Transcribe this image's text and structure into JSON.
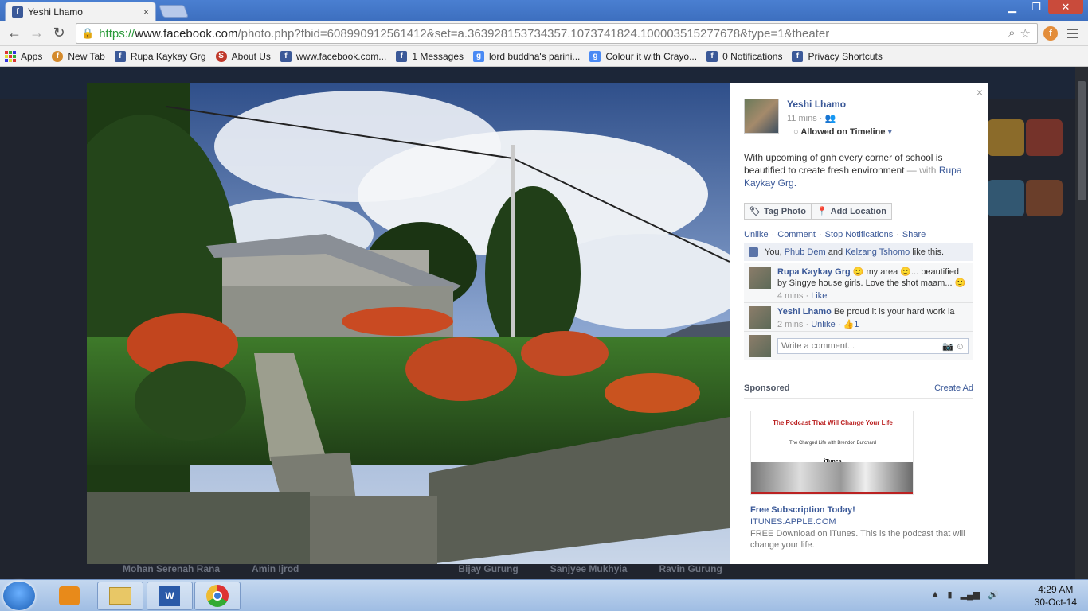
{
  "browser": {
    "tab_title": "Yeshi Lhamo",
    "tab_close": "×",
    "url_scheme": "https://",
    "url_host": "www.facebook.com",
    "url_path": "/photo.php?fbid=608990912561412&set=a.363928153734357.1073741824.100003515277678&type=1&theater",
    "window_controls": [
      "▁",
      "❐",
      "✕"
    ]
  },
  "bookmarks": [
    {
      "label": "Apps",
      "icon": "apps-icon"
    },
    {
      "label": "New Tab",
      "icon": "newtab-icon"
    },
    {
      "label": "Rupa Kaykay Grg",
      "icon": "facebook-icon"
    },
    {
      "label": "About Us",
      "icon": "site-icon"
    },
    {
      "label": "www.facebook.com...",
      "icon": "facebook-icon"
    },
    {
      "label": "1 Messages",
      "icon": "facebook-icon"
    },
    {
      "label": "lord buddha's parini...",
      "icon": "google-icon"
    },
    {
      "label": "Colour it with Crayo...",
      "icon": "google-icon"
    },
    {
      "label": "0 Notifications",
      "icon": "facebook-icon"
    },
    {
      "label": "Privacy Shortcuts",
      "icon": "facebook-icon"
    }
  ],
  "post": {
    "author": "Yeshi Lhamo",
    "time": "11 mins ·",
    "privacy": "Allowed on Timeline",
    "caption": "With upcoming of gnh every corner of school is beautified to create fresh environment",
    "with_text": "— with",
    "tagged": "Rupa Kaykay Grg",
    "tagged_end": ".",
    "buttons": {
      "tag_photo": "Tag Photo",
      "add_location": "Add Location"
    },
    "actions": {
      "unlike": "Unlike",
      "comment": "Comment",
      "stop_notifications": "Stop Notifications",
      "share": "Share",
      "sep": "·"
    },
    "likes": {
      "you": "You,",
      "p1": "Phub Dem",
      "and": "and",
      "p2": "Kelzang Tshomo",
      "tail": "like this."
    },
    "comments": [
      {
        "name": "Rupa Kaykay Grg",
        "text": "🙂 my area 🙂... beautified by Singye house girls. Love the shot maam... 🙂",
        "time": "4 mins ·",
        "action": "Like",
        "likes": ""
      },
      {
        "name": "Yeshi Lhamo",
        "text": "Be proud it is your hard work la",
        "time": "2 mins ·",
        "action": "Unlike",
        "likes": "· 👍1"
      }
    ],
    "write_placeholder": "Write a comment...",
    "close": "×"
  },
  "sponsored": {
    "title": "Sponsored",
    "create_ad": "Create Ad",
    "ad_headline": "The Podcast That Will Change Your Life",
    "ad_sub": "The Charged Life with Brendon Burchard",
    "ad_brand": "iTunes",
    "ad_title": "Free Subscription Today!",
    "ad_url": "ITUNES.APPLE.COM",
    "ad_desc": "FREE Download on iTunes. This is the podcast that will change your life."
  },
  "background_friends": [
    "Mohan Serenah Rana",
    "Amin Ijrod",
    "Bijay Gurung",
    "Sanjyee Mukhyia",
    "Ravin Gurung"
  ],
  "taskbar": {
    "time": "4:29 AM",
    "date": "30-Oct-14"
  }
}
